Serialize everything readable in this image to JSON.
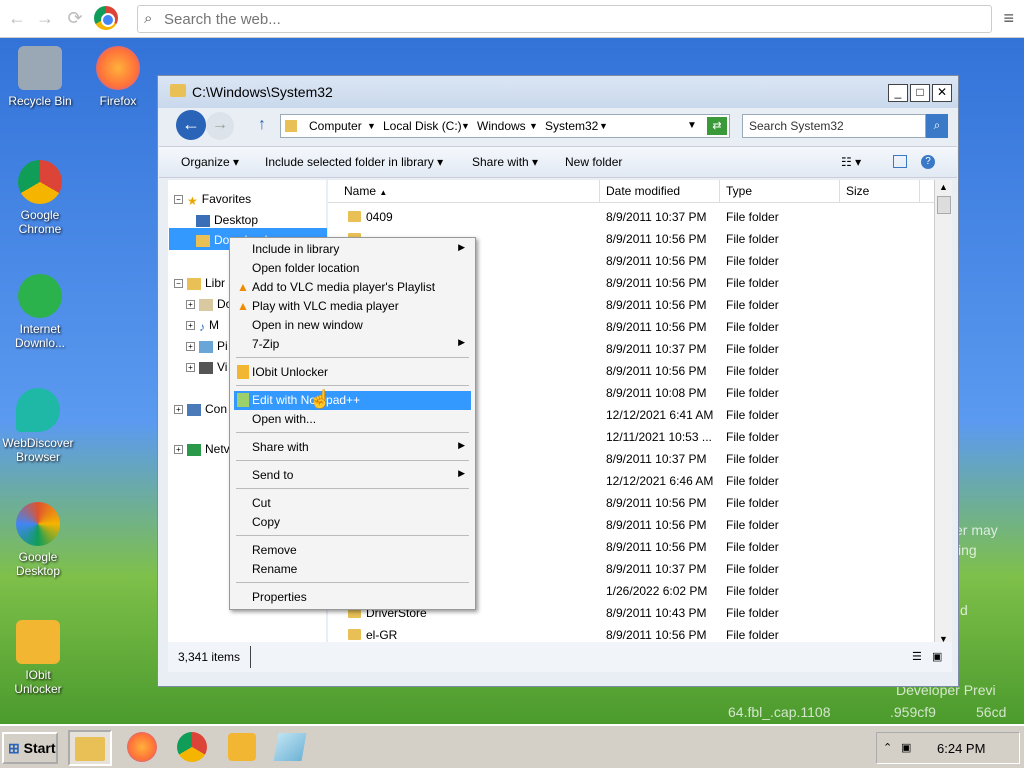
{
  "browser": {
    "back": "←",
    "forward": "→",
    "reload": "⟳",
    "search_placeholder": "Search the web...",
    "menu": "≡"
  },
  "desktop_icons": [
    {
      "label": "Recycle Bin",
      "icon": "recycle-bin-icon",
      "color": "#9aa7b5"
    },
    {
      "label": "Firefox",
      "icon": "firefox-icon",
      "color": "#ff7139"
    },
    {
      "label": "Google Chrome",
      "icon": "chrome-icon",
      "color": "#4285f4"
    },
    {
      "label": "Internet Downlo...",
      "icon": "idm-icon",
      "color": "#2bb24c"
    },
    {
      "label": "WebDiscover Browser",
      "icon": "webdiscover-icon",
      "color": "#1fb7a6"
    },
    {
      "label": "Google Desktop",
      "icon": "google-desktop-icon",
      "color": "#e0532e"
    },
    {
      "label": "IObit Unlocker",
      "icon": "iobit-unlocker-icon",
      "color": "#f2b632"
    }
  ],
  "window": {
    "title": "C:\\Windows\\System32",
    "min": "_",
    "max": "□",
    "close": "✕",
    "breadcrumbs": [
      "Computer",
      "Local Disk (C:)",
      "Windows",
      "System32"
    ],
    "search_placeholder": "Search System32"
  },
  "toolbar": {
    "organize": "Organize ▾",
    "include": "Include selected folder in library ▾",
    "share": "Share with ▾",
    "new_folder": "New folder"
  },
  "nav": {
    "favorites": "Favorites",
    "desktop": "Desktop",
    "downloads": "Downloads",
    "libraries": "Libr",
    "lib_items": [
      "Do",
      "M",
      "Pi",
      "Vi"
    ],
    "computer": "Con",
    "network": "Netv"
  },
  "columns": {
    "name": "Name",
    "date": "Date modified",
    "type": "Type",
    "size": "Size"
  },
  "files": [
    {
      "name": "0409",
      "date": "8/9/2011 10:37 PM",
      "type": "File folder"
    },
    {
      "name": "",
      "date": "8/9/2011 10:56 PM",
      "type": "File folder"
    },
    {
      "name": "",
      "date": "8/9/2011 10:56 PM",
      "type": "File folder"
    },
    {
      "name": "",
      "date": "8/9/2011 10:56 PM",
      "type": "File folder"
    },
    {
      "name": "",
      "date": "8/9/2011 10:56 PM",
      "type": "File folder"
    },
    {
      "name": "",
      "date": "8/9/2011 10:56 PM",
      "type": "File folder"
    },
    {
      "name": "",
      "date": "8/9/2011 10:37 PM",
      "type": "File folder"
    },
    {
      "name": "",
      "date": "8/9/2011 10:56 PM",
      "type": "File folder"
    },
    {
      "name": "",
      "date": "8/9/2011 10:08 PM",
      "type": "File folder"
    },
    {
      "name": "",
      "date": "12/12/2021 6:41 AM",
      "type": "File folder"
    },
    {
      "name": "",
      "date": "12/11/2021 10:53 ...",
      "type": "File folder"
    },
    {
      "name": "",
      "date": "8/9/2011 10:37 PM",
      "type": "File folder"
    },
    {
      "name": "",
      "date": "12/12/2021 6:46 AM",
      "type": "File folder"
    },
    {
      "name": "",
      "date": "8/9/2011 10:56 PM",
      "type": "File folder"
    },
    {
      "name": "",
      "date": "8/9/2011 10:56 PM",
      "type": "File folder"
    },
    {
      "name": "",
      "date": "8/9/2011 10:56 PM",
      "type": "File folder"
    },
    {
      "name": "",
      "date": "8/9/2011 10:37 PM",
      "type": "File folder"
    },
    {
      "name": "",
      "date": "1/26/2022 6:02 PM",
      "type": "File folder"
    },
    {
      "name": "DriverStore",
      "date": "8/9/2011 10:43 PM",
      "type": "File folder"
    },
    {
      "name": "el-GR",
      "date": "8/9/2011 10:56 PM",
      "type": "File folder"
    }
  ],
  "status": {
    "count": "3,341 items"
  },
  "context_menu": {
    "items": [
      {
        "label": "Include in library",
        "sub": true
      },
      {
        "label": "Open folder location"
      },
      {
        "label": "Add to VLC media player's Playlist",
        "icon": "vlc-icon"
      },
      {
        "label": "Play with VLC media player",
        "icon": "vlc-icon"
      },
      {
        "label": "Open in new window"
      },
      {
        "label": "7-Zip",
        "sub": true
      },
      {
        "label": "IObit Unlocker",
        "icon": "iobit-unlocker-icon"
      },
      {
        "label": "Edit with Notepad++",
        "icon": "notepad-plus-icon",
        "highlighted": true
      },
      {
        "label": "Open with..."
      },
      {
        "label": "Share with",
        "sub": true
      },
      {
        "label": "Send to",
        "sub": true
      },
      {
        "label": "Cut"
      },
      {
        "label": "Copy"
      },
      {
        "label": "Remove"
      },
      {
        "label": "Rename"
      },
      {
        "label": "Properties"
      }
    ]
  },
  "background_text": [
    "er may",
    "ing",
    "d",
    "Developer Previ",
    "64.fbl_.cap.1108",
    ".959cf9",
    "56cd"
  ],
  "taskbar": {
    "start": "Start",
    "apps": [
      "file-explorer-icon",
      "firefox-icon",
      "chrome-icon",
      "iobit-unlocker-icon",
      "notepad-icon"
    ],
    "time": "6:24 PM"
  },
  "colors": {
    "selection": "#3399ff",
    "folder": "#e8c055",
    "window_bg": "#e9eef5"
  }
}
